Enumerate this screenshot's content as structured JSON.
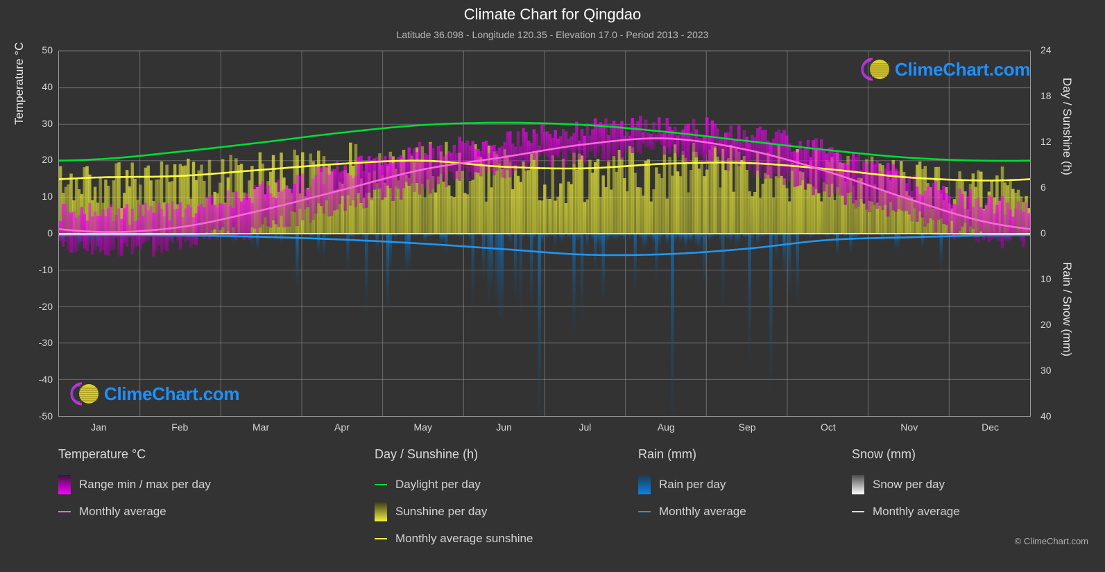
{
  "header": {
    "title": "Climate Chart for Qingdao",
    "subtitle": "Latitude 36.098 - Longitude 120.35 - Elevation 17.0 - Period 2013 - 2023"
  },
  "branding": {
    "logo_text": "ClimeChart.com",
    "copyright": "© ClimeChart.com",
    "logo_arc_color": "#d62fd6",
    "logo_sphere_color": "#e8d830",
    "logo_text_color": "#1e90ff"
  },
  "axes": {
    "left_label": "Temperature °C",
    "right_label_top": "Day / Sunshine (h)",
    "right_label_bottom": "Rain / Snow (mm)",
    "left_ticks": [
      "50",
      "40",
      "30",
      "20",
      "10",
      "0",
      "-10",
      "-20",
      "-30",
      "-40",
      "-50"
    ],
    "right_ticks_top": [
      "24",
      "18",
      "12",
      "6",
      "0"
    ],
    "right_ticks_bottom": [
      "10",
      "20",
      "30",
      "40"
    ],
    "x_ticks": [
      "Jan",
      "Feb",
      "Mar",
      "Apr",
      "May",
      "Jun",
      "Jul",
      "Aug",
      "Sep",
      "Oct",
      "Nov",
      "Dec"
    ]
  },
  "legend": {
    "groups": [
      {
        "title": "Temperature °C",
        "items": [
          {
            "label": "Range min / max per day",
            "type": "swatch",
            "color": "#ff00ff",
            "color2": "#3d1040"
          },
          {
            "label": "Monthly average",
            "type": "line",
            "color": "#ff66dd"
          }
        ]
      },
      {
        "title": "Day / Sunshine (h)",
        "items": [
          {
            "label": "Daylight per day",
            "type": "line",
            "color": "#00dd33"
          },
          {
            "label": "Sunshine per day",
            "type": "swatch",
            "color": "#f2f23a",
            "color2": "#3a3a20"
          },
          {
            "label": "Monthly average sunshine",
            "type": "line",
            "color": "#ffff44"
          }
        ]
      },
      {
        "title": "Rain (mm)",
        "items": [
          {
            "label": "Rain per day",
            "type": "swatch",
            "color": "#0a84e8",
            "color2": "#1b3a52"
          },
          {
            "label": "Monthly average",
            "type": "line",
            "color": "#2196f3"
          }
        ]
      },
      {
        "title": "Snow (mm)",
        "items": [
          {
            "label": "Snow per day",
            "type": "swatch",
            "color": "#ffffff",
            "color2": "#4a4a4a"
          },
          {
            "label": "Monthly average",
            "type": "line",
            "color": "#dddddd"
          }
        ]
      }
    ]
  },
  "chart_data": {
    "type": "line",
    "title": "Climate Chart for Qingdao",
    "subtitle": "Latitude 36.098 - Longitude 120.35 - Elevation 17.0 - Period 2013 - 2023",
    "xlabel": "",
    "ylabel": "Temperature °C",
    "ylim": [
      -50,
      50
    ],
    "y2lim_day_sunshine": [
      0,
      24
    ],
    "y2lim_rain_snow": [
      0,
      40
    ],
    "grid": true,
    "legend_position": "below",
    "categories": [
      "Jan",
      "Feb",
      "Mar",
      "Apr",
      "May",
      "Jun",
      "Jul",
      "Aug",
      "Sep",
      "Oct",
      "Nov",
      "Dec"
    ],
    "series": [
      {
        "name": "Monthly average temperature",
        "unit": "°C",
        "color": "#ff66dd",
        "values": [
          0.5,
          1.8,
          6.4,
          12.0,
          17.6,
          21.0,
          24.5,
          26.1,
          23.0,
          17.0,
          9.5,
          3.0
        ]
      },
      {
        "name": "Daylight per day",
        "unit": "h",
        "color": "#00dd33",
        "values": [
          9.8,
          10.8,
          12.0,
          13.3,
          14.3,
          14.6,
          14.3,
          13.4,
          12.2,
          11.0,
          10.0,
          9.6
        ]
      },
      {
        "name": "Monthly average sunshine",
        "unit": "h",
        "color": "#ffff44",
        "values": [
          7.4,
          7.6,
          8.4,
          9.2,
          9.6,
          8.8,
          8.6,
          9.2,
          9.3,
          8.5,
          7.4,
          7.0
        ]
      },
      {
        "name": "Monthly average rain",
        "unit": "mm",
        "color": "#2196f3",
        "values": [
          0.3,
          0.4,
          0.7,
          1.3,
          2.2,
          3.4,
          4.6,
          4.5,
          3.3,
          1.4,
          0.8,
          0.4
        ]
      },
      {
        "name": "Monthly average snow",
        "unit": "mm",
        "color": "#dddddd",
        "values": [
          0.1,
          0.1,
          0.0,
          0.0,
          0.0,
          0.0,
          0.0,
          0.0,
          0.0,
          0.0,
          0.0,
          0.1
        ]
      },
      {
        "name": "Daily temperature range max",
        "unit": "°C",
        "color": "#ff00ff",
        "values": [
          5.0,
          6.0,
          11.0,
          17.0,
          22.0,
          25.0,
          28.0,
          29.0,
          27.0,
          22.0,
          14.0,
          7.5
        ]
      },
      {
        "name": "Daily temperature range min",
        "unit": "°C",
        "color": "#ff00ff",
        "values": [
          -3.5,
          -2.5,
          2.0,
          8.0,
          13.5,
          18.0,
          22.0,
          23.0,
          19.0,
          12.0,
          5.0,
          -1.0
        ]
      }
    ]
  }
}
